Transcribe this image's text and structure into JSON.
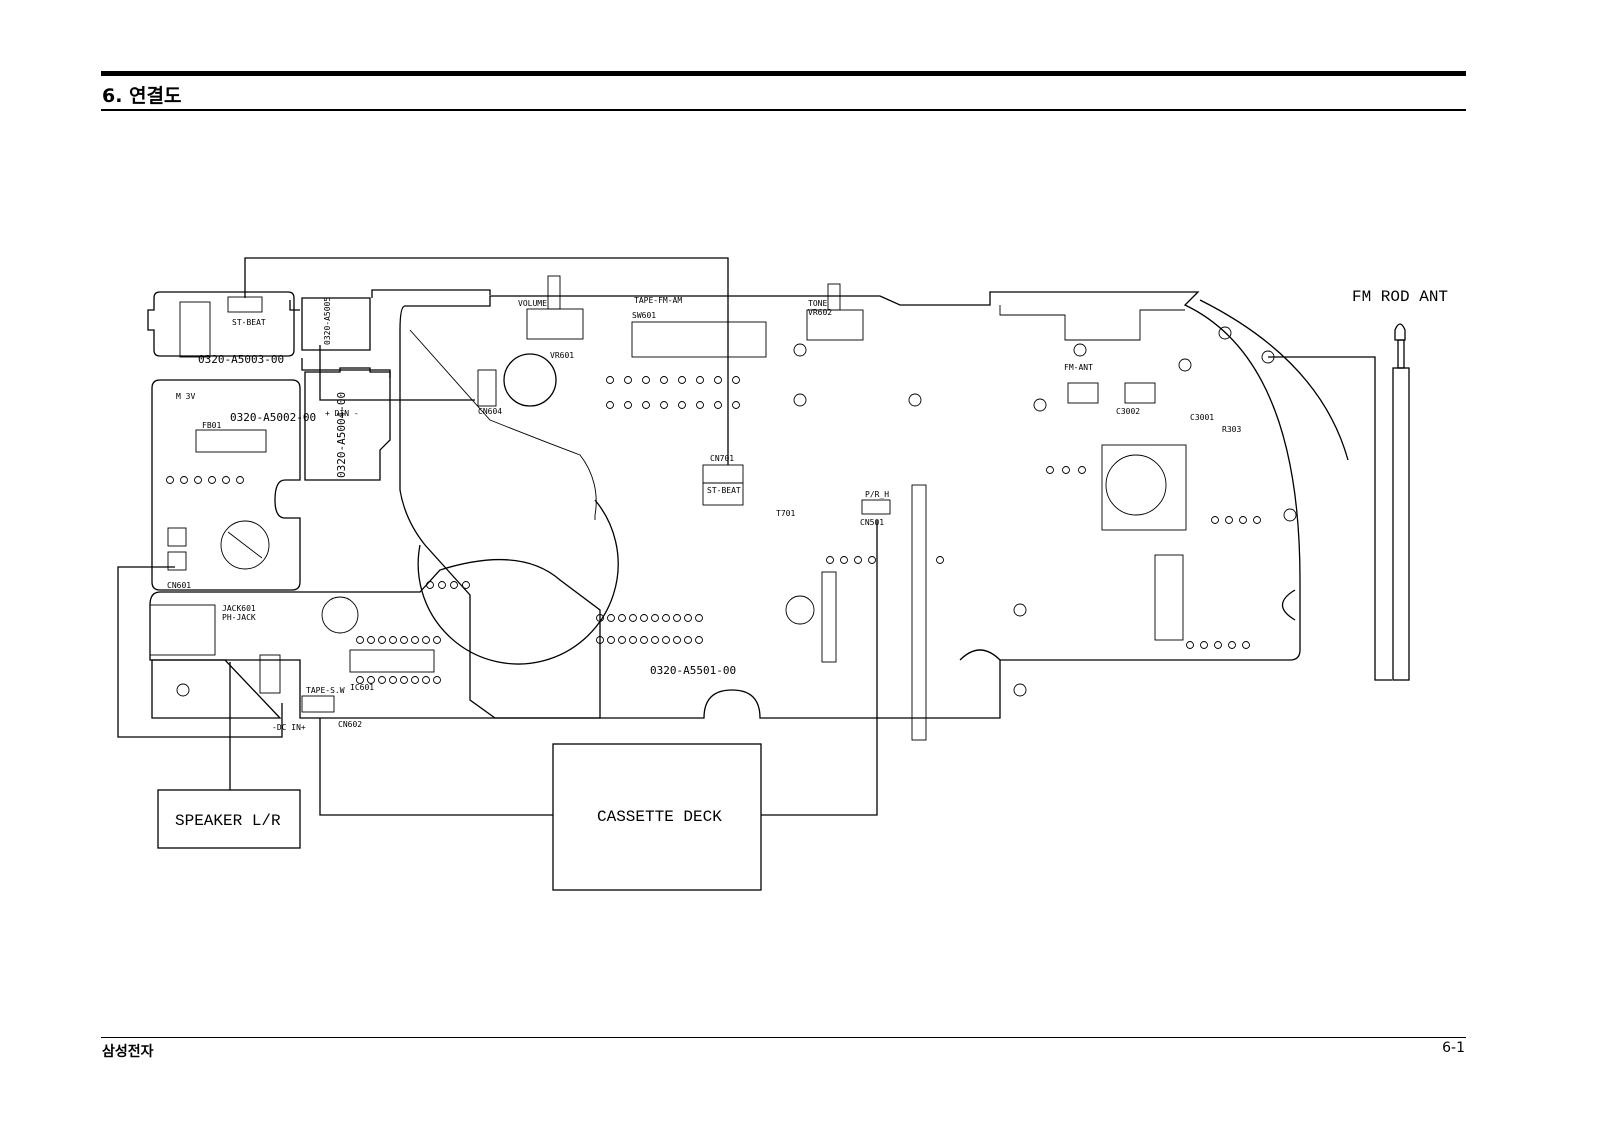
{
  "header": {
    "title": "6. 연결도"
  },
  "footer": {
    "company": "삼성전자",
    "page": "6-1"
  },
  "diagram": {
    "external": {
      "fm_rod_ant": "FM ROD ANT",
      "speaker": "SPEAKER L/R",
      "cassette_deck": "CASSETTE DECK"
    },
    "boards": {
      "st_beat_board": "0320-A5003-00",
      "power_board": "0320-A5002-00",
      "din_board": "0320-A5004-00",
      "main_board": "0320-A5501-00",
      "led_board": "0320-A5005"
    },
    "parts": {
      "st_beat": "ST-BEAT",
      "st_beat_2": "ST-BEAT",
      "cn701": "CN701",
      "volume": "VOLUME",
      "vr601": "VR601",
      "tone": "TONE",
      "vr602": "VR602",
      "tape_fm_am": "TAPE-FM-AM",
      "sw601": "SW601",
      "fm_ant": "FM-ANT",
      "din": "+ DIN -",
      "jack": "JACK601",
      "ph_jack": "PH-JACK",
      "tape_sw": "TAPE-S.W",
      "cn602": "CN602",
      "p_r_h": "P/R_H",
      "cn501": "CN501",
      "dc_in": "-DC IN+",
      "fb01": "FB01",
      "m_3v": "M 3V",
      "cn601": "CN601",
      "ic601": "IC601",
      "t701": "T701",
      "c3002": "C3002",
      "c3001": "C3001",
      "r303": "R303",
      "cn604": "CN604"
    }
  }
}
